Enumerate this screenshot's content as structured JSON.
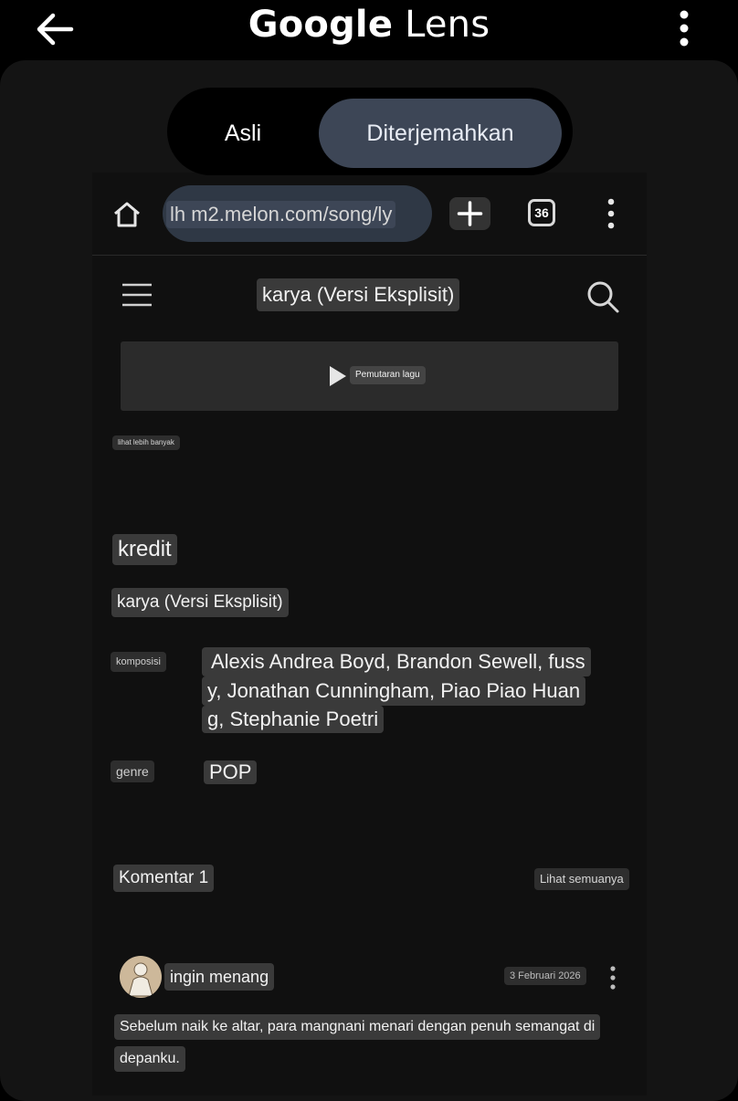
{
  "app": {
    "title_google": "Google",
    "title_lens": "Lens"
  },
  "toggle": {
    "original": "Asli",
    "translated": "Diterjemahkan"
  },
  "browser": {
    "url": "lh m2.melon.com/song/ly",
    "tab_count": "36"
  },
  "page": {
    "header_title": "karya (Versi Eksplisit)",
    "player_label": "Pemutaran lagu",
    "see_more": "lihat lebih banyak",
    "credits_heading": "kredit",
    "song_title": "karya (Versi Eksplisit)",
    "composition_label": "komposisi",
    "composers_line1": "Alexis Andrea Boyd, Brandon Sewell, fuss",
    "composers_line2": "y, Jonathan Cunningham, Piao Piao Huan",
    "composers_line3": "g, Stephanie Poetri",
    "genre_label": "genre",
    "genre_value": "POP",
    "comments_heading": "Komentar 1",
    "see_all": "Lihat semuanya"
  },
  "comment": {
    "user": "ingin menang",
    "date": "3 Februari 2026",
    "text_line1": "Sebelum naik ke altar, para mangnani menari dengan penuh semangat di",
    "text_line2": "depanku."
  },
  "colors": {
    "background": "#000000",
    "panel": "#141414",
    "selected_segment": "#3d4656",
    "chip": "#3a3a3a"
  }
}
